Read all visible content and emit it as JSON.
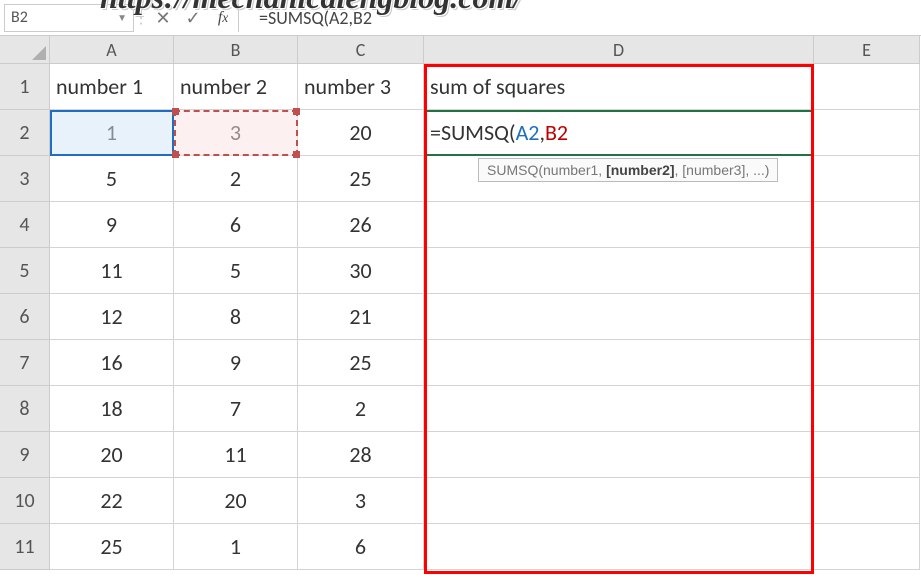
{
  "name_box": "B2",
  "formula_bar": "=SUMSQ(A2,B2",
  "col_headers": [
    "A",
    "B",
    "C",
    "D",
    "E"
  ],
  "row_headers": [
    "1",
    "2",
    "3",
    "4",
    "5",
    "6",
    "7",
    "8",
    "9",
    "10",
    "11"
  ],
  "headers_row": {
    "a": "number 1",
    "b": "number 2",
    "c": "number 3",
    "d": "sum of squares"
  },
  "rows": [
    {
      "a": "1",
      "b": "3",
      "c": "20"
    },
    {
      "a": "5",
      "b": "2",
      "c": "25"
    },
    {
      "a": "9",
      "b": "6",
      "c": "26"
    },
    {
      "a": "11",
      "b": "5",
      "c": "30"
    },
    {
      "a": "12",
      "b": "8",
      "c": "21"
    },
    {
      "a": "16",
      "b": "9",
      "c": "25"
    },
    {
      "a": "18",
      "b": "7",
      "c": "2"
    },
    {
      "a": "20",
      "b": "11",
      "c": "28"
    },
    {
      "a": "22",
      "b": "20",
      "c": "3"
    },
    {
      "a": "25",
      "b": "1",
      "c": "6"
    }
  ],
  "active_formula": {
    "prefix": "=SUMSQ(",
    "arg1": "A2",
    "sep": ",",
    "arg2": "B2"
  },
  "tooltip": {
    "fn": "SUMSQ",
    "n1": "number1",
    "n2": "[number2]",
    "n3": "[number3]",
    "rest": ", ...)"
  },
  "watermark": "https://mechanicalengblog.com/",
  "chart_data": {
    "type": "table",
    "title": "",
    "columns": [
      "number 1",
      "number 2",
      "number 3",
      "sum of squares"
    ],
    "rows": [
      [
        1,
        3,
        20,
        null
      ],
      [
        5,
        2,
        25,
        null
      ],
      [
        9,
        6,
        26,
        null
      ],
      [
        11,
        5,
        30,
        null
      ],
      [
        12,
        8,
        21,
        null
      ],
      [
        16,
        9,
        25,
        null
      ],
      [
        18,
        7,
        2,
        null
      ],
      [
        20,
        11,
        28,
        null
      ],
      [
        22,
        20,
        3,
        null
      ],
      [
        25,
        1,
        6,
        null
      ]
    ],
    "active_cell": "D2",
    "active_formula": "=SUMSQ(A2,B2"
  }
}
